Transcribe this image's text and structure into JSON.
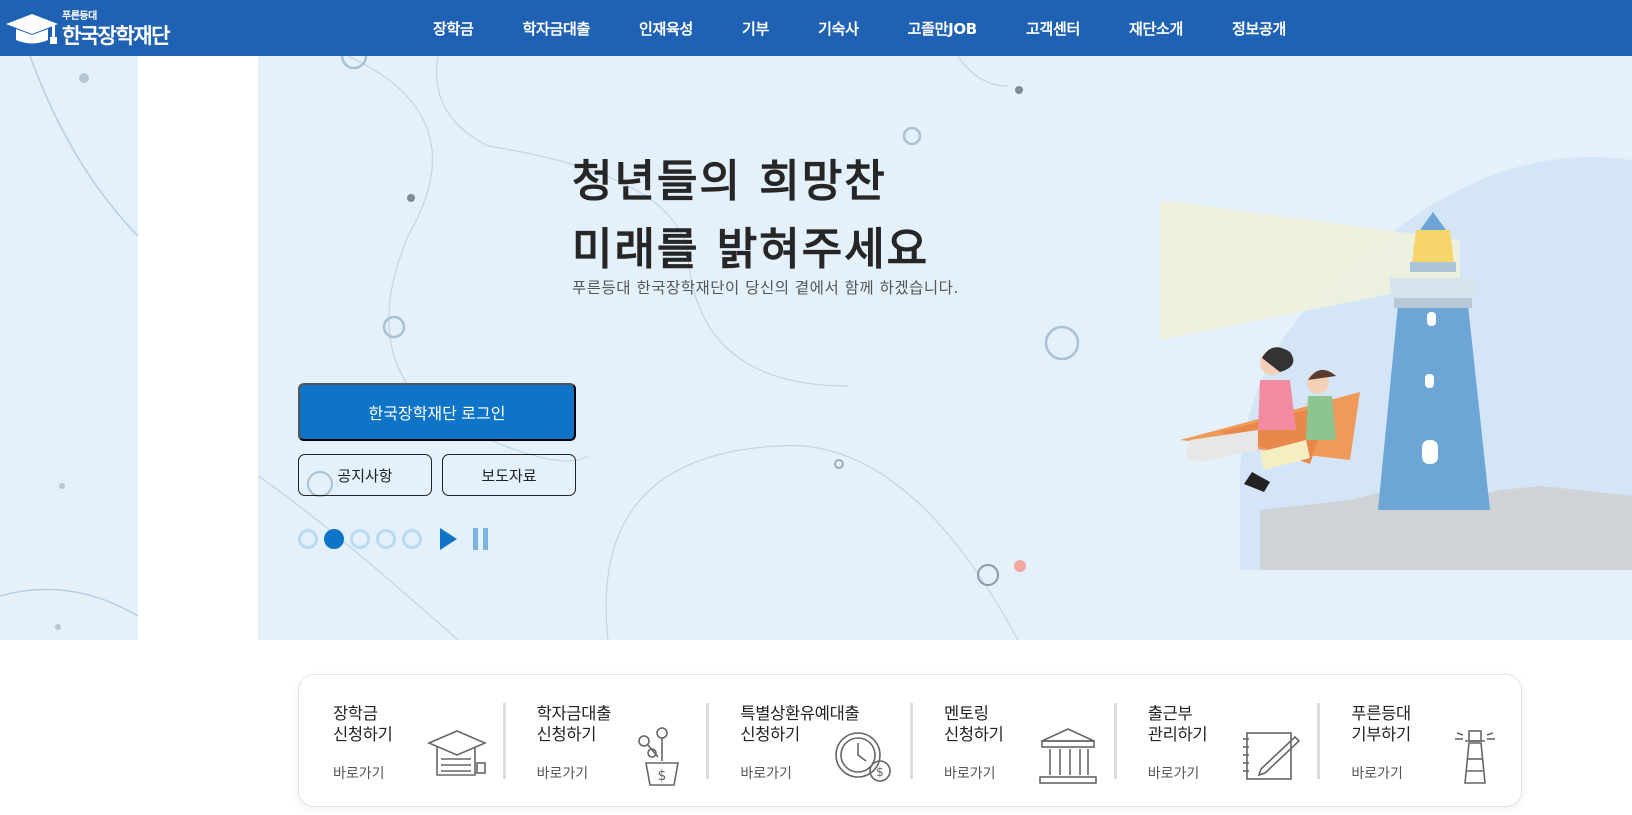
{
  "header": {
    "logo_small": "푸른등대",
    "logo_main": "한국장학재단",
    "nav": [
      {
        "label": "장학금"
      },
      {
        "label": "학자금대출"
      },
      {
        "label": "인재육성"
      },
      {
        "label": "기부"
      },
      {
        "label": "기숙사"
      },
      {
        "label": "고졸만JOB"
      },
      {
        "label": "고객센터"
      },
      {
        "label": "재단소개"
      },
      {
        "label": "정보공개"
      }
    ]
  },
  "hero": {
    "title_line1": "청년들의 희망찬",
    "title_line2": "미래를 밝혀주세요",
    "subtitle": "푸른등대 한국장학재단이 당신의 곁에서 함께 하겠습니다.",
    "login_label": "한국장학재단 로그인",
    "notice_label": "공지사항",
    "press_label": "보도자료",
    "slider": {
      "total": 5,
      "active_index": 2
    }
  },
  "quick_menu": [
    {
      "line1": "장학금",
      "line2": "신청하기",
      "link": "바로가기",
      "icon": "graduation-cap-icon"
    },
    {
      "line1": "학자금대출",
      "line2": "신청하기",
      "link": "바로가기",
      "icon": "money-plant-icon"
    },
    {
      "line1": "특별상환유예대출",
      "line2": "신청하기",
      "link": "바로가기",
      "icon": "clock-coins-icon"
    },
    {
      "line1": "멘토링",
      "line2": "신청하기",
      "link": "바로가기",
      "icon": "institution-icon"
    },
    {
      "line1": "출근부",
      "line2": "관리하기",
      "link": "바로가기",
      "icon": "notepad-pen-icon"
    },
    {
      "line1": "푸른등대",
      "line2": "기부하기",
      "link": "바로가기",
      "icon": "lighthouse-icon"
    }
  ],
  "colors": {
    "header_bg": "#1f62b3",
    "primary": "#0e74c8",
    "hero_bg": "#e4f1fb"
  }
}
